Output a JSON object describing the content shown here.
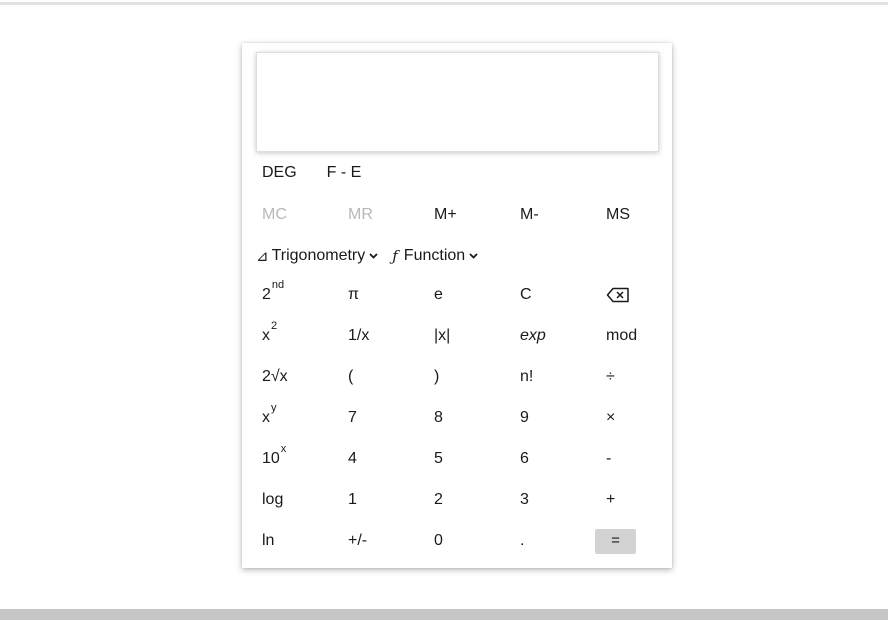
{
  "calculator": {
    "display_value": "",
    "modes": {
      "angle": "DEG",
      "format": "F - E"
    },
    "memory": [
      {
        "label": "MC",
        "enabled": false
      },
      {
        "label": "MR",
        "enabled": false
      },
      {
        "label": "M+",
        "enabled": true
      },
      {
        "label": "M-",
        "enabled": true
      },
      {
        "label": "MS",
        "enabled": true
      }
    ],
    "menus": {
      "trigonometry": {
        "icon": "⊿",
        "label": "Trigonometry"
      },
      "function": {
        "icon": "ƒ",
        "label": "Function"
      }
    },
    "keys": {
      "second": {
        "base": "2",
        "sup": "nd"
      },
      "pi": "π",
      "e": "e",
      "clear": "C",
      "backspace_icon": "backspace-icon",
      "square": {
        "base": "x",
        "sup": "2"
      },
      "reciprocal": "1/x",
      "abs": "|x|",
      "exp": "exp",
      "mod": "mod",
      "sqrt": "2√x",
      "open_paren": "(",
      "close_paren": ")",
      "factorial": "n!",
      "divide": "÷",
      "power": {
        "base": "x",
        "sup": "y"
      },
      "seven": "7",
      "eight": "8",
      "nine": "9",
      "multiply": "×",
      "ten_power": {
        "base": "10",
        "sup": "x"
      },
      "four": "4",
      "five": "5",
      "six": "6",
      "subtract": "-",
      "log": "log",
      "one": "1",
      "two": "2",
      "three": "3",
      "add": "+",
      "ln": "ln",
      "negate": "+/-",
      "zero": "0",
      "decimal": ".",
      "equals": "="
    }
  },
  "colors": {
    "disabled_text": "#b8b8b8",
    "equals_bg": "#d3d3d3",
    "bottom_bar": "#c6c6c6"
  }
}
